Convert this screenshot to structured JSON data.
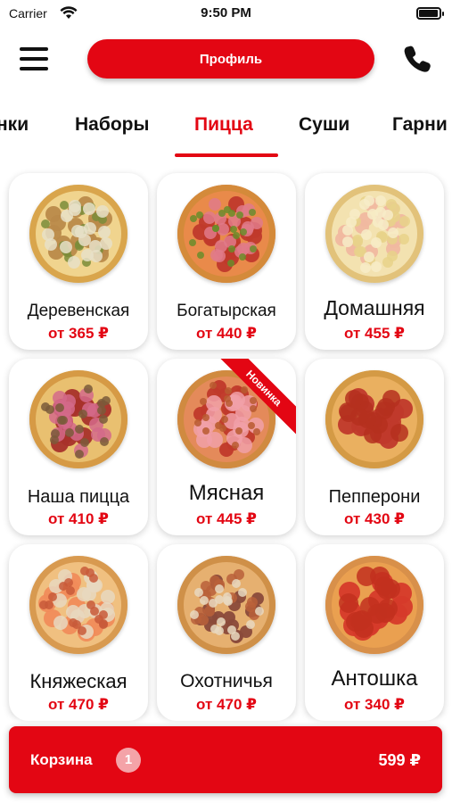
{
  "status_bar": {
    "carrier": "Carrier",
    "time": "9:50 PM",
    "battery_level": 0.95
  },
  "header": {
    "menu_icon": "hamburger-menu-icon",
    "profile_label": "Профиль",
    "phone_icon": "phone-icon"
  },
  "tabs": [
    {
      "label": "нки",
      "active": false
    },
    {
      "label": "Наборы",
      "active": false
    },
    {
      "label": "Пицца",
      "active": true
    },
    {
      "label": "Суши",
      "active": false
    },
    {
      "label": "Гарни",
      "active": false
    }
  ],
  "products": [
    {
      "name": "Деревенская",
      "price": "от 365 ₽",
      "badge": ""
    },
    {
      "name": "Богатырская",
      "price": "от 440 ₽",
      "badge": ""
    },
    {
      "name": "Домашняя",
      "price": "от 455 ₽",
      "badge": ""
    },
    {
      "name": "Наша пицца",
      "price": "от 410 ₽",
      "badge": ""
    },
    {
      "name": "Мясная",
      "price": "от 445 ₽",
      "badge": "Новинка"
    },
    {
      "name": "Пепперони",
      "price": "от 430 ₽",
      "badge": ""
    },
    {
      "name": "Княжеская",
      "price": "от 470 ₽",
      "badge": ""
    },
    {
      "name": "Охотничья",
      "price": "от 470 ₽",
      "badge": ""
    },
    {
      "name": "Антошка",
      "price": "от 340 ₽",
      "badge": ""
    }
  ],
  "cart": {
    "label": "Корзина",
    "count": "1",
    "total": "599 ₽"
  },
  "colors": {
    "accent": "#e30613",
    "text": "#111111",
    "background": "#ffffff"
  }
}
